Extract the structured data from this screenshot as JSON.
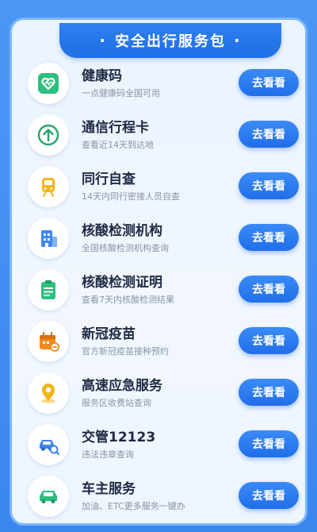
{
  "header": {
    "dot_left": "·",
    "title": "安全出行服务包",
    "dot_right": "·"
  },
  "items": [
    {
      "title": "健康码",
      "subtitle": "一点健康码全国可用",
      "button": "去看看",
      "icon": "health-code-icon",
      "color": "#2dbf7d"
    },
    {
      "title": "通信行程卡",
      "subtitle": "查看近14天到达地",
      "button": "去看看",
      "icon": "itinerary-arrow-icon",
      "color": "#2aa36a"
    },
    {
      "title": "同行自查",
      "subtitle": "14天内同行密接人员自查",
      "button": "去看看",
      "icon": "train-icon",
      "color": "#f1b51c"
    },
    {
      "title": "核酸检测机构",
      "subtitle": "全国核酸检测机构查询",
      "button": "去看看",
      "icon": "hospital-building-icon",
      "color": "#3f86f0"
    },
    {
      "title": "核酸检测证明",
      "subtitle": "查看7天内核酸检测结果",
      "button": "去看看",
      "icon": "clipboard-icon",
      "color": "#2dbf7d"
    },
    {
      "title": "新冠疫苗",
      "subtitle": "官方新冠疫苗接种预约",
      "button": "去看看",
      "icon": "calendar-vaccine-icon",
      "color": "#f08a1c"
    },
    {
      "title": "高速应急服务",
      "subtitle": "服务区收费站查询",
      "button": "去看看",
      "icon": "location-pin-icon",
      "color": "#f1b51c"
    },
    {
      "title": "交管12123",
      "subtitle": "违法违章查询",
      "button": "去看看",
      "icon": "car-search-icon",
      "color": "#3f86f0"
    },
    {
      "title": "车主服务",
      "subtitle": "加油、ETC更多服务一键办",
      "button": "去看看",
      "icon": "car-icon",
      "color": "#2dbf7d"
    }
  ]
}
